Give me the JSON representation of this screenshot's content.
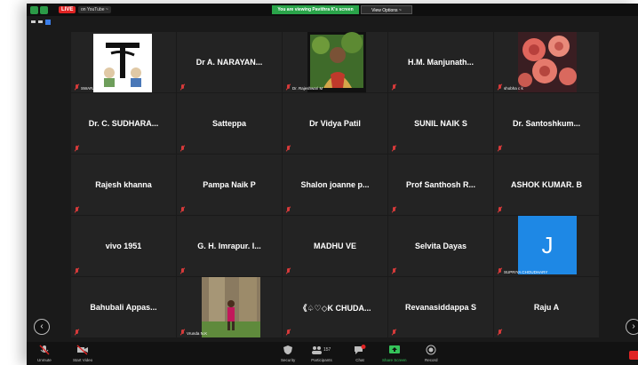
{
  "topbar": {
    "live_label": "LIVE",
    "on_youtube": "on YouTube ~",
    "sharing_banner": "You are viewing Pavithra K's screen",
    "view_options": "View Options ~"
  },
  "tiles": [
    {
      "name": "",
      "label": "SWARAJ OF LIFE..."
    },
    {
      "name": "Dr A. NARAYAN...",
      "label": ""
    },
    {
      "name": "",
      "label": "Dr. Rajeshwari M"
    },
    {
      "name": "H.M. Manjunath...",
      "label": ""
    },
    {
      "name": "",
      "label": "shobha c k"
    },
    {
      "name": "Dr. C. SUDHARA...",
      "label": ""
    },
    {
      "name": "Satteppa",
      "label": ""
    },
    {
      "name": "Dr Vidya Patil",
      "label": ""
    },
    {
      "name": "SUNIL NAIK S",
      "label": ""
    },
    {
      "name": "Dr. Santoshkum...",
      "label": ""
    },
    {
      "name": "Rajesh khanna",
      "label": ""
    },
    {
      "name": "Pampa Naik P",
      "label": ""
    },
    {
      "name": "Shalon joanne p...",
      "label": ""
    },
    {
      "name": "Prof Santhosh R...",
      "label": ""
    },
    {
      "name": "ASHOK KUMAR. B",
      "label": ""
    },
    {
      "name": "vivo 1951",
      "label": ""
    },
    {
      "name": "G. H. Imrapur. I...",
      "label": ""
    },
    {
      "name": "MADHU VE",
      "label": ""
    },
    {
      "name": "Selvita Dayas",
      "label": ""
    },
    {
      "name": "",
      "label": "SUPRIYA CHOUDHARY",
      "avatar_letter": "J"
    },
    {
      "name": "Bahubali Appas...",
      "label": ""
    },
    {
      "name": "",
      "label": "Vrunda N.K"
    },
    {
      "name": "《♤♡◇K CHUDA...",
      "label": ""
    },
    {
      "name": "Revanasiddappa S",
      "label": ""
    },
    {
      "name": "Raju A",
      "label": ""
    }
  ],
  "toolbar": {
    "unmute": "Unmute",
    "start_video": "Start Video",
    "security": "Security",
    "participants": "Participants",
    "participants_count": "157",
    "chat": "Chat",
    "share_screen": "Share Screen",
    "record": "Record"
  },
  "colors": {
    "share_green": "#35c35a",
    "live_red": "#e02424",
    "avatar_blue": "#1e88e5"
  }
}
